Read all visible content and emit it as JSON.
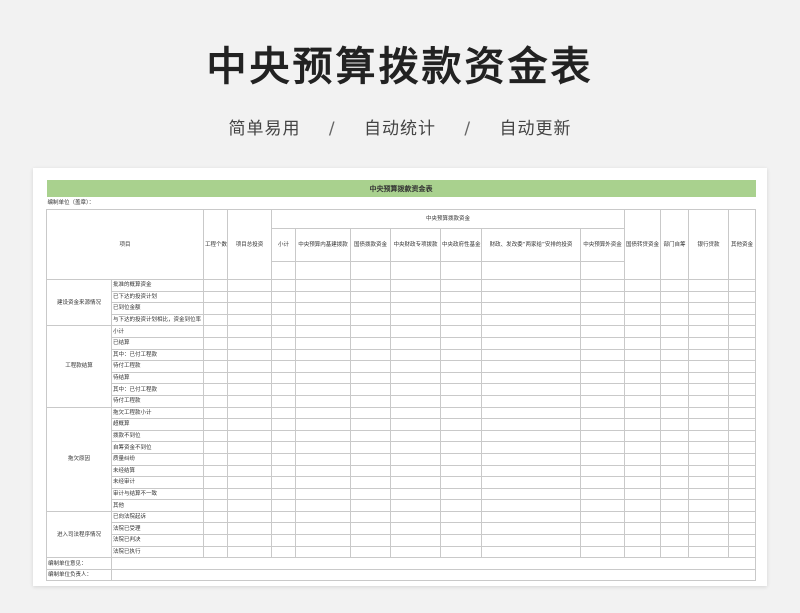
{
  "page": {
    "title": "中央预算拨款资金表",
    "features": [
      "简单易用",
      "自动统计",
      "自动更新"
    ],
    "separator": "/"
  },
  "sheet": {
    "banner": "中央预算拨款资金表",
    "unit_label": "编制单位（盖章）：",
    "header": {
      "item": "项目",
      "project_count": "工程个数",
      "total_investment": "项目总投资",
      "central_group": "中央预算拨款资金",
      "subtotal": "小计",
      "central_capital": "中央预算内基建拨款",
      "treasury_bond": "国债拨款资金",
      "fiscal_special": "中央财政专项拨款",
      "gov_fund": "中央政府性基金",
      "ndrc": "财政、发改委“两家给”安排的投资",
      "outside_budget": "中央预算外资金",
      "bond_transfer": "国债转贷资金",
      "self_raised": "部门自筹",
      "bank_loan": "银行贷款",
      "other_funds": "其他资金"
    },
    "groups": [
      {
        "label": "建设资金来源情况",
        "rows": [
          "批准的概算资金",
          "已下达的投资计划",
          "已到位金额",
          "与下达的投资计划相比，资金到位率"
        ]
      },
      {
        "label": "工程款结算",
        "rows": [
          "小计",
          "已结算",
          "其中：已付工程款",
          "待付工程款",
          "待结算",
          "其中：已付工程款",
          "待付工程款"
        ]
      },
      {
        "label": "拖欠原因",
        "rows": [
          "拖欠工程款小计",
          "超概算",
          "拨款不到位",
          "自筹资金不到位",
          "质量纠纷",
          "未经结算",
          "未经审计",
          "审计与结算不一致",
          "其他"
        ]
      },
      {
        "label": "进入司法程序情况",
        "rows": [
          "已向法院起诉",
          "法院已受理",
          "法院已判决",
          "法院已执行"
        ]
      }
    ],
    "footer": {
      "opinion": "编制单位意见：",
      "leader": "编制单位负责人："
    }
  }
}
